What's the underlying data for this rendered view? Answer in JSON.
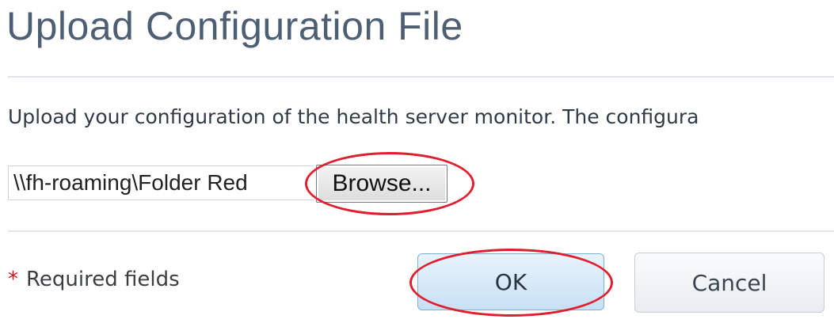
{
  "dialog": {
    "title": "Upload Configuration File",
    "description": "Upload your configuration of the health server monitor. The configura"
  },
  "file_picker": {
    "path_value": "\\\\fh-roaming\\Folder Red",
    "browse_label": "Browse..."
  },
  "footer": {
    "required_asterisk": "*",
    "required_label": "Required fields",
    "ok_label": "OK",
    "cancel_label": "Cancel"
  },
  "annotations": {
    "highlight_color": "#e01e2e"
  }
}
